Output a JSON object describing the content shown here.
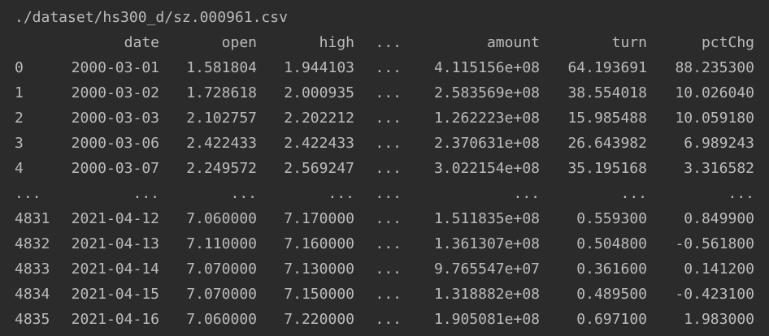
{
  "path": "./dataset/hs300_d/sz.000961.csv",
  "columns": {
    "date": "date",
    "open": "open",
    "high": "high",
    "ellipsis": "...",
    "amount": "amount",
    "turn": "turn",
    "pctChg": "pctChg"
  },
  "rows": [
    {
      "idx": "0",
      "date": "2000-03-01",
      "open": "1.581804",
      "high": "1.944103",
      "ellipsis": "...",
      "amount": "4.115156e+08",
      "turn": "64.193691",
      "pctChg": "88.235300"
    },
    {
      "idx": "1",
      "date": "2000-03-02",
      "open": "1.728618",
      "high": "2.000935",
      "ellipsis": "...",
      "amount": "2.583569e+08",
      "turn": "38.554018",
      "pctChg": "10.026040"
    },
    {
      "idx": "2",
      "date": "2000-03-03",
      "open": "2.102757",
      "high": "2.202212",
      "ellipsis": "...",
      "amount": "1.262223e+08",
      "turn": "15.985488",
      "pctChg": "10.059180"
    },
    {
      "idx": "3",
      "date": "2000-03-06",
      "open": "2.422433",
      "high": "2.422433",
      "ellipsis": "...",
      "amount": "2.370631e+08",
      "turn": "26.643982",
      "pctChg": "6.989243"
    },
    {
      "idx": "4",
      "date": "2000-03-07",
      "open": "2.249572",
      "high": "2.569247",
      "ellipsis": "...",
      "amount": "3.022154e+08",
      "turn": "35.195168",
      "pctChg": "3.316582"
    },
    {
      "idx": "...",
      "date": "...",
      "open": "...",
      "high": "...",
      "ellipsis": "...",
      "amount": "...",
      "turn": "...",
      "pctChg": "..."
    },
    {
      "idx": "4831",
      "date": "2021-04-12",
      "open": "7.060000",
      "high": "7.170000",
      "ellipsis": "...",
      "amount": "1.511835e+08",
      "turn": "0.559300",
      "pctChg": "0.849900"
    },
    {
      "idx": "4832",
      "date": "2021-04-13",
      "open": "7.110000",
      "high": "7.160000",
      "ellipsis": "...",
      "amount": "1.361307e+08",
      "turn": "0.504800",
      "pctChg": "-0.561800"
    },
    {
      "idx": "4833",
      "date": "2021-04-14",
      "open": "7.070000",
      "high": "7.130000",
      "ellipsis": "...",
      "amount": "9.765547e+07",
      "turn": "0.361600",
      "pctChg": "0.141200"
    },
    {
      "idx": "4834",
      "date": "2021-04-15",
      "open": "7.070000",
      "high": "7.150000",
      "ellipsis": "...",
      "amount": "1.318882e+08",
      "turn": "0.489500",
      "pctChg": "-0.423100"
    },
    {
      "idx": "4835",
      "date": "2021-04-16",
      "open": "7.060000",
      "high": "7.220000",
      "ellipsis": "...",
      "amount": "1.905081e+08",
      "turn": "0.697100",
      "pctChg": "1.983000"
    }
  ]
}
